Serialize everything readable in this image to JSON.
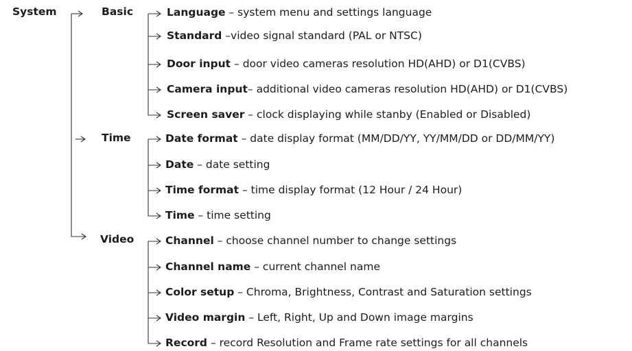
{
  "root": {
    "label": "System"
  },
  "sections": [
    {
      "label": "Basic",
      "items": [
        {
          "name": "Language",
          "desc": " – system menu and settings language"
        },
        {
          "name": "Standard",
          "desc": " –video signal standard  (PAL or NTSC)"
        },
        {
          "name": "Door input",
          "desc": " – door video cameras resolution HD(AHD) or D1(CVBS)"
        },
        {
          "name": "Camera input",
          "desc": "– additional video cameras resolution HD(AHD) or D1(CVBS)"
        },
        {
          "name": "Screen saver",
          "desc": " – clock displaying while stanby (Enabled or Disabled)"
        }
      ]
    },
    {
      "label": "Time",
      "items": [
        {
          "name": "Date format",
          "desc": " – date display format (MM/DD/YY, YY/MM/DD or DD/MM/YY)"
        },
        {
          "name": "Date",
          "desc": " – date setting"
        },
        {
          "name": "Time format",
          "desc": " – time display format (12 Hour / 24 Hour)"
        },
        {
          "name": "Time",
          "desc": " – time setting"
        }
      ]
    },
    {
      "label": "Video",
      "items": [
        {
          "name": "Channel",
          "desc": " – choose channel number to change settings"
        },
        {
          "name": "Channel name",
          "desc": " – current channel name"
        },
        {
          "name": "Color setup",
          "desc": " – Chroma, Brightness, Contrast and Saturation settings"
        },
        {
          "name": "Video margin",
          "desc": "  – Left, Right, Up and Down image margins"
        },
        {
          "name": "Record",
          "desc": "  – record Resolution and Frame rate settings for all channels"
        }
      ]
    }
  ]
}
